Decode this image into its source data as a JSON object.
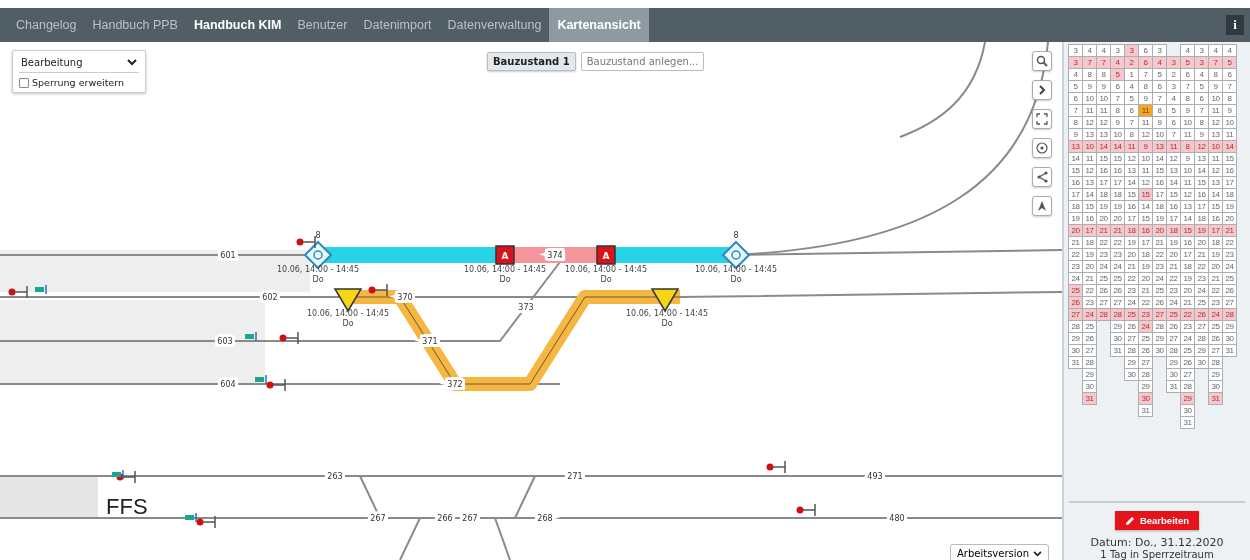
{
  "tabs": [
    {
      "label": "Changelog",
      "selected": false,
      "emphasized": false
    },
    {
      "label": "Handbuch PPB",
      "selected": false,
      "emphasized": false
    },
    {
      "label": "Handbuch KIM",
      "selected": false,
      "emphasized": true
    },
    {
      "label": "Benutzer",
      "selected": false,
      "emphasized": false
    },
    {
      "label": "Datenimport",
      "selected": false,
      "emphasized": false
    },
    {
      "label": "Datenverwaltung",
      "selected": false,
      "emphasized": false
    },
    {
      "label": "Kartenansicht",
      "selected": true,
      "emphasized": false
    }
  ],
  "info_button": "i",
  "mode_panel": {
    "mode": "Bearbeitung",
    "extend_closure": {
      "label": "Sperrung erweitern",
      "checked": false
    }
  },
  "construction_states": [
    {
      "label": "Bauzustand 1",
      "selected": true
    },
    {
      "label": "Bauzustand anlegen...",
      "selected": false
    }
  ],
  "map": {
    "track_labels": [
      "601",
      "602",
      "603",
      "604",
      "370",
      "371",
      "372",
      "373",
      "374",
      "263",
      "271",
      "493",
      "267",
      "266",
      "267",
      "268",
      "480"
    ],
    "km_marks": [
      "8",
      "8"
    ],
    "closure_marks": [
      "A",
      "A"
    ],
    "schedule_labels": [
      {
        "time": "10.06, 14:00 - 14:45",
        "weekday": "Do"
      },
      {
        "time": "10.06, 14:00 - 14:45",
        "weekday": "Do"
      },
      {
        "time": "10.06, 14:00 - 14:45",
        "weekday": "Do"
      },
      {
        "time": "10.06, 14:00 - 14:45",
        "weekday": "Do"
      },
      {
        "time": "10.06, 14:00 - 14:45",
        "weekday": "Do"
      },
      {
        "time": "10.06, 14:00 - 14:45",
        "weekday": "Do"
      }
    ],
    "area_label": "FFS"
  },
  "version_select": "Arbeitsversion",
  "calendar": {
    "rows": [
      {
        "cells": [
          {
            "day": "3",
            "blocked": false,
            "today": false
          },
          {
            "day": "4",
            "blocked": false,
            "today": false
          },
          {
            "day": "4",
            "blocked": false,
            "today": false
          },
          {
            "day": "3",
            "blocked": false,
            "today": false
          },
          {
            "day": "3",
            "blocked": true,
            "today": false
          },
          {
            "day": "6",
            "blocked": false,
            "today": false
          },
          {
            "day": "3",
            "blocked": false,
            "today": false
          },
          null,
          {
            "day": "4",
            "blocked": false,
            "today": false
          },
          {
            "day": "3",
            "blocked": false,
            "today": false
          },
          {
            "day": "4",
            "blocked": false,
            "today": false
          },
          {
            "day": "4",
            "blocked": false,
            "today": false
          }
        ]
      },
      {
        "cells": [
          {
            "day": "3",
            "blocked": true,
            "today": false
          },
          {
            "day": "7",
            "blocked": true,
            "today": false
          },
          {
            "day": "7",
            "blocked": true,
            "today": false
          },
          {
            "day": "4",
            "blocked": true,
            "today": false
          },
          {
            "day": "2",
            "blocked": true,
            "today": false
          },
          {
            "day": "6",
            "blocked": true,
            "today": false
          },
          {
            "day": "4",
            "blocked": true,
            "today": false
          },
          {
            "day": "3",
            "blocked": true,
            "today": false
          },
          {
            "day": "5",
            "blocked": true,
            "today": false
          },
          {
            "day": "3",
            "blocked": true,
            "today": false
          },
          {
            "day": "7",
            "blocked": true,
            "today": false
          },
          {
            "day": "5",
            "blocked": true,
            "today": false
          }
        ]
      },
      {
        "cells": [
          {
            "day": "4",
            "blocked": false,
            "today": false
          },
          {
            "day": "8",
            "blocked": false,
            "today": false
          },
          {
            "day": "8",
            "blocked": false,
            "today": false
          },
          {
            "day": "5",
            "blocked": true,
            "today": false
          },
          {
            "day": "1",
            "blocked": false,
            "today": false
          },
          {
            "day": "7",
            "blocked": false,
            "today": false
          },
          {
            "day": "5",
            "blocked": false,
            "today": false
          },
          {
            "day": "2",
            "blocked": false,
            "today": false
          },
          {
            "day": "6",
            "blocked": false,
            "today": false
          },
          {
            "day": "4",
            "blocked": false,
            "today": false
          },
          {
            "day": "8",
            "blocked": false,
            "today": false
          },
          {
            "day": "6",
            "blocked": false,
            "today": false
          }
        ]
      },
      {
        "cells": [
          {
            "day": "5",
            "blocked": false,
            "today": false
          },
          {
            "day": "9",
            "blocked": false,
            "today": false
          },
          {
            "day": "9",
            "blocked": false,
            "today": false
          },
          {
            "day": "6",
            "blocked": false,
            "today": false
          },
          {
            "day": "4",
            "blocked": false,
            "today": false
          },
          {
            "day": "8",
            "blocked": false,
            "today": false
          },
          {
            "day": "6",
            "blocked": false,
            "today": false
          },
          {
            "day": "3",
            "blocked": false,
            "today": false
          },
          {
            "day": "7",
            "blocked": false,
            "today": false
          },
          {
            "day": "5",
            "blocked": false,
            "today": false
          },
          {
            "day": "9",
            "blocked": false,
            "today": false
          },
          {
            "day": "7",
            "blocked": false,
            "today": false
          }
        ]
      },
      {
        "cells": [
          {
            "day": "6",
            "blocked": false,
            "today": false
          },
          {
            "day": "10",
            "blocked": false,
            "today": false
          },
          {
            "day": "10",
            "blocked": false,
            "today": false
          },
          {
            "day": "7",
            "blocked": false,
            "today": false
          },
          {
            "day": "5",
            "blocked": false,
            "today": false
          },
          {
            "day": "9",
            "blocked": false,
            "today": false
          },
          {
            "day": "7",
            "blocked": false,
            "today": false
          },
          {
            "day": "4",
            "blocked": false,
            "today": false
          },
          {
            "day": "8",
            "blocked": false,
            "today": false
          },
          {
            "day": "6",
            "blocked": false,
            "today": false
          },
          {
            "day": "10",
            "blocked": false,
            "today": false
          },
          {
            "day": "8",
            "blocked": false,
            "today": false
          }
        ]
      },
      {
        "cells": [
          {
            "day": "7",
            "blocked": false,
            "today": false
          },
          {
            "day": "11",
            "blocked": false,
            "today": false
          },
          {
            "day": "11",
            "blocked": false,
            "today": false
          },
          {
            "day": "8",
            "blocked": false,
            "today": false
          },
          {
            "day": "6",
            "blocked": false,
            "today": false
          },
          {
            "day": "11",
            "blocked": false,
            "today": true
          },
          {
            "day": "8",
            "blocked": false,
            "today": false
          },
          {
            "day": "5",
            "blocked": false,
            "today": false
          },
          {
            "day": "9",
            "blocked": false,
            "today": false
          },
          {
            "day": "7",
            "blocked": false,
            "today": false
          },
          {
            "day": "11",
            "blocked": false,
            "today": false
          },
          {
            "day": "9",
            "blocked": false,
            "today": false
          }
        ]
      },
      {
        "cells": [
          {
            "day": "8",
            "blocked": false,
            "today": false
          },
          {
            "day": "12",
            "blocked": false,
            "today": false
          },
          {
            "day": "12",
            "blocked": false,
            "today": false
          },
          {
            "day": "9",
            "blocked": false,
            "today": false
          },
          {
            "day": "7",
            "blocked": false,
            "today": false
          },
          {
            "day": "11",
            "blocked": false,
            "today": false
          },
          {
            "day": "9",
            "blocked": false,
            "today": false
          },
          {
            "day": "6",
            "blocked": false,
            "today": false
          },
          {
            "day": "10",
            "blocked": false,
            "today": false
          },
          {
            "day": "8",
            "blocked": false,
            "today": false
          },
          {
            "day": "12",
            "blocked": false,
            "today": false
          },
          {
            "day": "10",
            "blocked": false,
            "today": false
          }
        ]
      },
      {
        "cells": [
          {
            "day": "9",
            "blocked": false,
            "today": false
          },
          {
            "day": "13",
            "blocked": false,
            "today": false
          },
          {
            "day": "13",
            "blocked": false,
            "today": false
          },
          {
            "day": "10",
            "blocked": false,
            "today": false
          },
          {
            "day": "8",
            "blocked": false,
            "today": false
          },
          {
            "day": "12",
            "blocked": false,
            "today": false
          },
          {
            "day": "10",
            "blocked": false,
            "today": false
          },
          {
            "day": "7",
            "blocked": false,
            "today": false
          },
          {
            "day": "11",
            "blocked": false,
            "today": false
          },
          {
            "day": "9",
            "blocked": false,
            "today": false
          },
          {
            "day": "13",
            "blocked": false,
            "today": false
          },
          {
            "day": "11",
            "blocked": false,
            "today": false
          }
        ]
      },
      {
        "cells": [
          {
            "day": "13",
            "blocked": true,
            "today": false
          },
          {
            "day": "10",
            "blocked": true,
            "today": false
          },
          {
            "day": "14",
            "blocked": true,
            "today": false
          },
          {
            "day": "14",
            "blocked": true,
            "today": false
          },
          {
            "day": "11",
            "blocked": true,
            "today": false
          },
          {
            "day": "9",
            "blocked": true,
            "today": false
          },
          {
            "day": "13",
            "blocked": true,
            "today": false
          },
          {
            "day": "11",
            "blocked": true,
            "today": false
          },
          {
            "day": "8",
            "blocked": true,
            "today": false
          },
          {
            "day": "12",
            "blocked": true,
            "today": false
          },
          {
            "day": "10",
            "blocked": true,
            "today": false
          },
          {
            "day": "14",
            "blocked": true,
            "today": false
          }
        ]
      },
      {
        "cells": [
          {
            "day": "14",
            "blocked": false,
            "today": false
          },
          {
            "day": "11",
            "blocked": false,
            "today": false
          },
          {
            "day": "15",
            "blocked": false,
            "today": false
          },
          {
            "day": "15",
            "blocked": false,
            "today": false
          },
          {
            "day": "12",
            "blocked": false,
            "today": false
          },
          {
            "day": "10",
            "blocked": false,
            "today": false
          },
          {
            "day": "14",
            "blocked": false,
            "today": false
          },
          {
            "day": "12",
            "blocked": false,
            "today": false
          },
          {
            "day": "9",
            "blocked": false,
            "today": false
          },
          {
            "day": "13",
            "blocked": false,
            "today": false
          },
          {
            "day": "11",
            "blocked": false,
            "today": false
          },
          {
            "day": "15",
            "blocked": false,
            "today": false
          }
        ]
      },
      {
        "cells": [
          {
            "day": "15",
            "blocked": false,
            "today": false
          },
          {
            "day": "12",
            "blocked": false,
            "today": false
          },
          {
            "day": "16",
            "blocked": false,
            "today": false
          },
          {
            "day": "16",
            "blocked": false,
            "today": false
          },
          {
            "day": "13",
            "blocked": false,
            "today": false
          },
          {
            "day": "11",
            "blocked": false,
            "today": false
          },
          {
            "day": "15",
            "blocked": false,
            "today": false
          },
          {
            "day": "13",
            "blocked": false,
            "today": false
          },
          {
            "day": "10",
            "blocked": false,
            "today": false
          },
          {
            "day": "14",
            "blocked": false,
            "today": false
          },
          {
            "day": "12",
            "blocked": false,
            "today": false
          },
          {
            "day": "16",
            "blocked": false,
            "today": false
          }
        ]
      },
      {
        "cells": [
          {
            "day": "16",
            "blocked": false,
            "today": false
          },
          {
            "day": "13",
            "blocked": false,
            "today": false
          },
          {
            "day": "17",
            "blocked": false,
            "today": false
          },
          {
            "day": "17",
            "blocked": false,
            "today": false
          },
          {
            "day": "14",
            "blocked": false,
            "today": false
          },
          {
            "day": "12",
            "blocked": false,
            "today": false
          },
          {
            "day": "16",
            "blocked": false,
            "today": false
          },
          {
            "day": "14",
            "blocked": false,
            "today": false
          },
          {
            "day": "11",
            "blocked": false,
            "today": false
          },
          {
            "day": "15",
            "blocked": false,
            "today": false
          },
          {
            "day": "13",
            "blocked": false,
            "today": false
          },
          {
            "day": "17",
            "blocked": false,
            "today": false
          }
        ]
      },
      {
        "cells": [
          {
            "day": "17",
            "blocked": false,
            "today": false
          },
          {
            "day": "14",
            "blocked": false,
            "today": false
          },
          {
            "day": "18",
            "blocked": false,
            "today": false
          },
          {
            "day": "18",
            "blocked": false,
            "today": false
          },
          {
            "day": "15",
            "blocked": false,
            "today": false
          },
          {
            "day": "15",
            "blocked": true,
            "today": false
          },
          {
            "day": "17",
            "blocked": false,
            "today": false
          },
          {
            "day": "15",
            "blocked": false,
            "today": false
          },
          {
            "day": "12",
            "blocked": false,
            "today": false
          },
          {
            "day": "16",
            "blocked": false,
            "today": false
          },
          {
            "day": "14",
            "blocked": false,
            "today": false
          },
          {
            "day": "18",
            "blocked": false,
            "today": false
          }
        ]
      },
      {
        "cells": [
          {
            "day": "18",
            "blocked": false,
            "today": false
          },
          {
            "day": "15",
            "blocked": false,
            "today": false
          },
          {
            "day": "19",
            "blocked": false,
            "today": false
          },
          {
            "day": "19",
            "blocked": false,
            "today": false
          },
          {
            "day": "16",
            "blocked": false,
            "today": false
          },
          {
            "day": "14",
            "blocked": false,
            "today": false
          },
          {
            "day": "18",
            "blocked": false,
            "today": false
          },
          {
            "day": "16",
            "blocked": false,
            "today": false
          },
          {
            "day": "13",
            "blocked": false,
            "today": false
          },
          {
            "day": "17",
            "blocked": false,
            "today": false
          },
          {
            "day": "15",
            "blocked": false,
            "today": false
          },
          {
            "day": "19",
            "blocked": false,
            "today": false
          }
        ]
      },
      {
        "cells": [
          {
            "day": "19",
            "blocked": false,
            "today": false
          },
          {
            "day": "16",
            "blocked": false,
            "today": false
          },
          {
            "day": "20",
            "blocked": false,
            "today": false
          },
          {
            "day": "20",
            "blocked": false,
            "today": false
          },
          {
            "day": "17",
            "blocked": false,
            "today": false
          },
          {
            "day": "15",
            "blocked": false,
            "today": false
          },
          {
            "day": "19",
            "blocked": false,
            "today": false
          },
          {
            "day": "17",
            "blocked": false,
            "today": false
          },
          {
            "day": "14",
            "blocked": false,
            "today": false
          },
          {
            "day": "18",
            "blocked": false,
            "today": false
          },
          {
            "day": "16",
            "blocked": false,
            "today": false
          },
          {
            "day": "20",
            "blocked": false,
            "today": false
          }
        ]
      },
      {
        "cells": [
          {
            "day": "20",
            "blocked": true,
            "today": false
          },
          {
            "day": "17",
            "blocked": true,
            "today": false
          },
          {
            "day": "21",
            "blocked": true,
            "today": false
          },
          {
            "day": "21",
            "blocked": true,
            "today": false
          },
          {
            "day": "18",
            "blocked": true,
            "today": false
          },
          {
            "day": "16",
            "blocked": true,
            "today": false
          },
          {
            "day": "20",
            "blocked": true,
            "today": false
          },
          {
            "day": "18",
            "blocked": true,
            "today": false
          },
          {
            "day": "15",
            "blocked": true,
            "today": false
          },
          {
            "day": "19",
            "blocked": true,
            "today": false
          },
          {
            "day": "17",
            "blocked": true,
            "today": false
          },
          {
            "day": "21",
            "blocked": true,
            "today": false
          }
        ]
      },
      {
        "cells": [
          {
            "day": "21",
            "blocked": false,
            "today": false
          },
          {
            "day": "18",
            "blocked": false,
            "today": false
          },
          {
            "day": "22",
            "blocked": false,
            "today": false
          },
          {
            "day": "22",
            "blocked": false,
            "today": false
          },
          {
            "day": "19",
            "blocked": false,
            "today": false
          },
          {
            "day": "17",
            "blocked": false,
            "today": false
          },
          {
            "day": "21",
            "blocked": false,
            "today": false
          },
          {
            "day": "19",
            "blocked": false,
            "today": false
          },
          {
            "day": "16",
            "blocked": false,
            "today": false
          },
          {
            "day": "20",
            "blocked": false,
            "today": false
          },
          {
            "day": "18",
            "blocked": false,
            "today": false
          },
          {
            "day": "22",
            "blocked": false,
            "today": false
          }
        ]
      },
      {
        "cells": [
          {
            "day": "22",
            "blocked": false,
            "today": false
          },
          {
            "day": "19",
            "blocked": false,
            "today": false
          },
          {
            "day": "23",
            "blocked": false,
            "today": false
          },
          {
            "day": "23",
            "blocked": false,
            "today": false
          },
          {
            "day": "20",
            "blocked": false,
            "today": false
          },
          {
            "day": "18",
            "blocked": false,
            "today": false
          },
          {
            "day": "22",
            "blocked": false,
            "today": false
          },
          {
            "day": "20",
            "blocked": false,
            "today": false
          },
          {
            "day": "17",
            "blocked": false,
            "today": false
          },
          {
            "day": "21",
            "blocked": false,
            "today": false
          },
          {
            "day": "19",
            "blocked": false,
            "today": false
          },
          {
            "day": "23",
            "blocked": false,
            "today": false
          }
        ]
      },
      {
        "cells": [
          {
            "day": "23",
            "blocked": false,
            "today": false
          },
          {
            "day": "20",
            "blocked": false,
            "today": false
          },
          {
            "day": "24",
            "blocked": false,
            "today": false
          },
          {
            "day": "24",
            "blocked": false,
            "today": false
          },
          {
            "day": "21",
            "blocked": false,
            "today": false
          },
          {
            "day": "19",
            "blocked": false,
            "today": false
          },
          {
            "day": "23",
            "blocked": false,
            "today": false
          },
          {
            "day": "21",
            "blocked": false,
            "today": false
          },
          {
            "day": "18",
            "blocked": false,
            "today": false
          },
          {
            "day": "22",
            "blocked": false,
            "today": false
          },
          {
            "day": "20",
            "blocked": false,
            "today": false
          },
          {
            "day": "24",
            "blocked": false,
            "today": false
          }
        ]
      },
      {
        "cells": [
          {
            "day": "24",
            "blocked": false,
            "today": false
          },
          {
            "day": "21",
            "blocked": false,
            "today": false
          },
          {
            "day": "25",
            "blocked": false,
            "today": false
          },
          {
            "day": "25",
            "blocked": false,
            "today": false
          },
          {
            "day": "22",
            "blocked": false,
            "today": false
          },
          {
            "day": "20",
            "blocked": false,
            "today": false
          },
          {
            "day": "24",
            "blocked": false,
            "today": false
          },
          {
            "day": "22",
            "blocked": false,
            "today": false
          },
          {
            "day": "19",
            "blocked": false,
            "today": false
          },
          {
            "day": "23",
            "blocked": false,
            "today": false
          },
          {
            "day": "21",
            "blocked": false,
            "today": false
          },
          {
            "day": "25",
            "blocked": false,
            "today": false
          }
        ]
      },
      {
        "cells": [
          {
            "day": "25",
            "blocked": true,
            "today": false
          },
          {
            "day": "22",
            "blocked": false,
            "today": false
          },
          {
            "day": "26",
            "blocked": false,
            "today": false
          },
          {
            "day": "26",
            "blocked": false,
            "today": false
          },
          {
            "day": "23",
            "blocked": false,
            "today": false
          },
          {
            "day": "21",
            "blocked": false,
            "today": false
          },
          {
            "day": "25",
            "blocked": false,
            "today": false
          },
          {
            "day": "23",
            "blocked": false,
            "today": false
          },
          {
            "day": "20",
            "blocked": false,
            "today": false
          },
          {
            "day": "24",
            "blocked": false,
            "today": false
          },
          {
            "day": "22",
            "blocked": false,
            "today": false
          },
          {
            "day": "26",
            "blocked": false,
            "today": false
          }
        ]
      },
      {
        "cells": [
          {
            "day": "26",
            "blocked": true,
            "today": false
          },
          {
            "day": "23",
            "blocked": false,
            "today": false
          },
          {
            "day": "27",
            "blocked": false,
            "today": false
          },
          {
            "day": "27",
            "blocked": false,
            "today": false
          },
          {
            "day": "24",
            "blocked": false,
            "today": false
          },
          {
            "day": "22",
            "blocked": false,
            "today": false
          },
          {
            "day": "26",
            "blocked": false,
            "today": false
          },
          {
            "day": "24",
            "blocked": false,
            "today": false
          },
          {
            "day": "21",
            "blocked": false,
            "today": false
          },
          {
            "day": "25",
            "blocked": false,
            "today": false
          },
          {
            "day": "23",
            "blocked": false,
            "today": false
          },
          {
            "day": "27",
            "blocked": false,
            "today": false
          }
        ]
      },
      {
        "cells": [
          {
            "day": "27",
            "blocked": true,
            "today": false
          },
          {
            "day": "24",
            "blocked": true,
            "today": false
          },
          {
            "day": "28",
            "blocked": true,
            "today": false
          },
          {
            "day": "28",
            "blocked": true,
            "today": false
          },
          {
            "day": "25",
            "blocked": true,
            "today": false
          },
          {
            "day": "23",
            "blocked": true,
            "today": false
          },
          {
            "day": "27",
            "blocked": true,
            "today": false
          },
          {
            "day": "25",
            "blocked": true,
            "today": false
          },
          {
            "day": "22",
            "blocked": true,
            "today": false
          },
          {
            "day": "26",
            "blocked": true,
            "today": false
          },
          {
            "day": "24",
            "blocked": true,
            "today": false
          },
          {
            "day": "28",
            "blocked": true,
            "today": false
          }
        ]
      },
      {
        "cells": [
          {
            "day": "28",
            "blocked": false,
            "today": false
          },
          {
            "day": "25",
            "blocked": false,
            "today": false
          },
          null,
          {
            "day": "29",
            "blocked": false,
            "today": false
          },
          {
            "day": "26",
            "blocked": false,
            "today": false
          },
          {
            "day": "24",
            "blocked": true,
            "today": false
          },
          {
            "day": "28",
            "blocked": false,
            "today": false
          },
          {
            "day": "26",
            "blocked": false,
            "today": false
          },
          {
            "day": "23",
            "blocked": false,
            "today": false
          },
          {
            "day": "27",
            "blocked": false,
            "today": false
          },
          {
            "day": "25",
            "blocked": false,
            "today": false
          },
          {
            "day": "29",
            "blocked": false,
            "today": false
          }
        ]
      },
      {
        "cells": [
          {
            "day": "29",
            "blocked": false,
            "today": false
          },
          {
            "day": "26",
            "blocked": false,
            "today": false
          },
          null,
          {
            "day": "30",
            "blocked": false,
            "today": false
          },
          {
            "day": "27",
            "blocked": false,
            "today": false
          },
          {
            "day": "25",
            "blocked": false,
            "today": false
          },
          {
            "day": "29",
            "blocked": false,
            "today": false
          },
          {
            "day": "27",
            "blocked": false,
            "today": false
          },
          {
            "day": "24",
            "blocked": false,
            "today": false
          },
          {
            "day": "28",
            "blocked": false,
            "today": false
          },
          {
            "day": "26",
            "blocked": false,
            "today": false
          },
          {
            "day": "30",
            "blocked": false,
            "today": false
          }
        ]
      },
      {
        "cells": [
          {
            "day": "30",
            "blocked": false,
            "today": false
          },
          {
            "day": "27",
            "blocked": false,
            "today": false
          },
          null,
          {
            "day": "31",
            "blocked": false,
            "today": false
          },
          {
            "day": "28",
            "blocked": false,
            "today": false
          },
          {
            "day": "26",
            "blocked": false,
            "today": false
          },
          {
            "day": "30",
            "blocked": false,
            "today": false
          },
          {
            "day": "28",
            "blocked": false,
            "today": false
          },
          {
            "day": "25",
            "blocked": false,
            "today": false
          },
          {
            "day": "29",
            "blocked": false,
            "today": false
          },
          {
            "day": "27",
            "blocked": false,
            "today": false
          },
          {
            "day": "31",
            "blocked": false,
            "today": false
          }
        ]
      },
      {
        "cells": [
          {
            "day": "31",
            "blocked": false,
            "today": false
          },
          {
            "day": "28",
            "blocked": false,
            "today": false
          },
          null,
          null,
          {
            "day": "29",
            "blocked": false,
            "today": false
          },
          {
            "day": "27",
            "blocked": false,
            "today": false
          },
          null,
          {
            "day": "29",
            "blocked": false,
            "today": false
          },
          {
            "day": "26",
            "blocked": false,
            "today": false
          },
          {
            "day": "30",
            "blocked": false,
            "today": false
          },
          {
            "day": "28",
            "blocked": false,
            "today": false
          },
          null
        ]
      },
      {
        "cells": [
          null,
          {
            "day": "29",
            "blocked": false,
            "today": false
          },
          null,
          null,
          {
            "day": "30",
            "blocked": false,
            "today": false
          },
          {
            "day": "28",
            "blocked": false,
            "today": false
          },
          null,
          {
            "day": "30",
            "blocked": false,
            "today": false
          },
          {
            "day": "27",
            "blocked": false,
            "today": false
          },
          null,
          {
            "day": "29",
            "blocked": false,
            "today": false
          },
          null
        ]
      },
      {
        "cells": [
          null,
          {
            "day": "30",
            "blocked": false,
            "today": false
          },
          null,
          null,
          null,
          {
            "day": "29",
            "blocked": false,
            "today": false
          },
          null,
          {
            "day": "31",
            "blocked": false,
            "today": false
          },
          {
            "day": "28",
            "blocked": false,
            "today": false
          },
          null,
          {
            "day": "30",
            "blocked": false,
            "today": false
          },
          null
        ]
      },
      {
        "cells": [
          null,
          {
            "day": "31",
            "blocked": true,
            "today": false
          },
          null,
          null,
          null,
          {
            "day": "30",
            "blocked": true,
            "today": false
          },
          null,
          null,
          {
            "day": "29",
            "blocked": true,
            "today": false
          },
          null,
          {
            "day": "31",
            "blocked": true,
            "today": false
          },
          null
        ]
      },
      {
        "cells": [
          null,
          null,
          null,
          null,
          null,
          {
            "day": "31",
            "blocked": false,
            "today": false
          },
          null,
          null,
          {
            "day": "30",
            "blocked": false,
            "today": false
          },
          null,
          null,
          null
        ]
      },
      {
        "cells": [
          null,
          null,
          null,
          null,
          null,
          null,
          null,
          null,
          {
            "day": "31",
            "blocked": false,
            "today": false
          },
          null,
          null,
          null
        ]
      }
    ]
  },
  "edit_button": "Bearbeiten",
  "date_line": "Datum: Do., 31.12.2020",
  "period_line": "1 Tag in Sperrzeitraum"
}
